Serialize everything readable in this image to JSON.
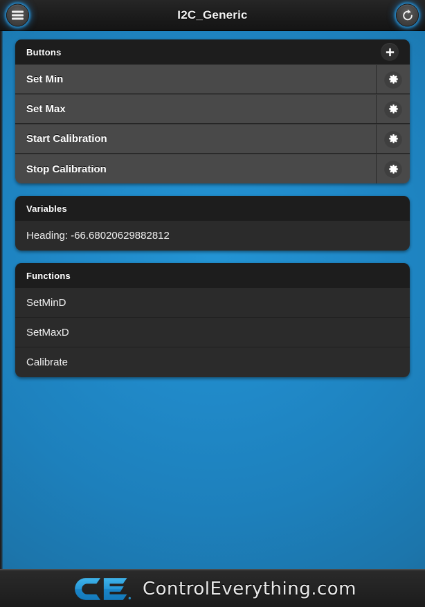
{
  "app": {
    "title": "I2C_Generic",
    "accent_blue": "#2089c8",
    "panel_dark": "#1d1d1d",
    "row_gray": "#494949",
    "row_dark": "#2b2b2b"
  },
  "topbar": {
    "menu_icon": "hamburger-menu-icon",
    "title": "I2C_Generic",
    "refresh_icon": "refresh-icon"
  },
  "panels": {
    "buttons": {
      "header": "Buttons",
      "add_icon": "plus-icon",
      "rows": [
        {
          "label": "Set Min",
          "gear_icon": "gear-icon"
        },
        {
          "label": "Set Max",
          "gear_icon": "gear-icon"
        },
        {
          "label": "Start Calibration",
          "gear_icon": "gear-icon"
        },
        {
          "label": "Stop Calibration",
          "gear_icon": "gear-icon"
        }
      ]
    },
    "variables": {
      "header": "Variables",
      "rows": [
        {
          "label": "Heading: -66.68020629882812"
        }
      ]
    },
    "functions": {
      "header": "Functions",
      "rows": [
        {
          "label": "SetMinD"
        },
        {
          "label": "SetMaxD"
        },
        {
          "label": "Calibrate"
        }
      ]
    }
  },
  "footer": {
    "logo_icon": "ce-logo-icon",
    "brand": "ControlEverything.com"
  }
}
